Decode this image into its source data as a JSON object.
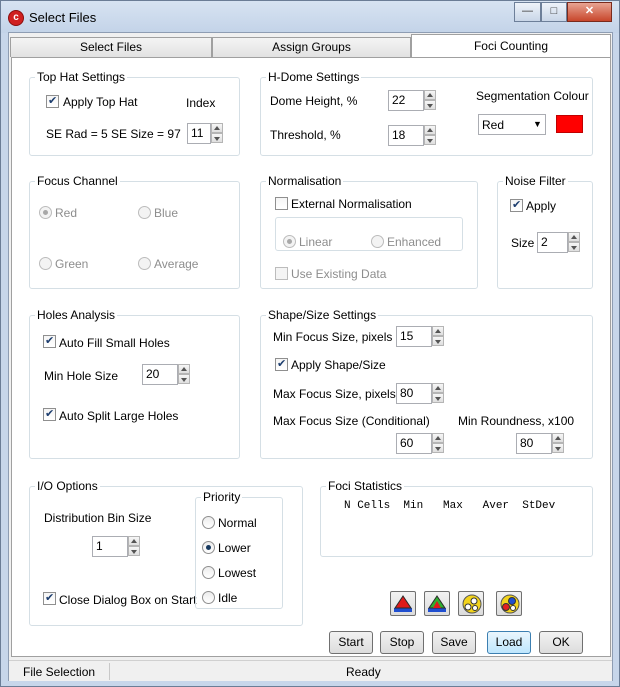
{
  "window": {
    "title": "Select Files",
    "app_icon_glyph": "c"
  },
  "caption_buttons": {
    "minimize": "—",
    "maximize": "□",
    "close": "✕"
  },
  "tabs": [
    {
      "label": "Select Files"
    },
    {
      "label": "Assign Groups"
    },
    {
      "label": "Foci Counting",
      "active": true
    }
  ],
  "top_hat": {
    "legend": "Top Hat Settings",
    "apply_label": "Apply Top Hat",
    "apply_checked": true,
    "index_label": "Index",
    "se_text": "SE Rad = 5  SE Size = 97",
    "index_value": "11"
  },
  "h_dome": {
    "legend": "H-Dome Settings",
    "dome_height_label": "Dome Height, %",
    "dome_height_value": "22",
    "threshold_label": "Threshold, %",
    "threshold_value": "18",
    "seg_colour_label": "Segmentation Colour",
    "seg_colour_value": "Red",
    "seg_colour_hex": "#ff0000"
  },
  "focus_channel": {
    "legend": "Focus Channel",
    "options": [
      "Red",
      "Blue",
      "Green",
      "Average"
    ],
    "selected": "Red"
  },
  "normalisation": {
    "legend": "Normalisation",
    "external_label": "External Normalisation",
    "options": [
      "Linear",
      "Enhanced"
    ],
    "selected": "Linear",
    "use_existing_label": "Use Existing Data"
  },
  "noise_filter": {
    "legend": "Noise Filter",
    "apply_label": "Apply",
    "apply_checked": true,
    "size_label": "Size",
    "size_value": "2"
  },
  "holes": {
    "legend": "Holes Analysis",
    "auto_fill_label": "Auto Fill Small Holes",
    "auto_fill_checked": true,
    "min_hole_label": "Min Hole Size",
    "min_hole_value": "20",
    "auto_split_label": "Auto Split Large Holes",
    "auto_split_checked": true
  },
  "shape": {
    "legend": "Shape/Size Settings",
    "min_focus_label": "Min Focus Size, pixels",
    "min_focus_value": "15",
    "apply_label": "Apply Shape/Size",
    "apply_checked": true,
    "max_focus_label": "Max Focus Size, pixels",
    "max_focus_value": "80",
    "max_cond_label": "Max Focus Size  (Conditional)",
    "max_cond_value": "60",
    "min_round_label": "Min Roundness, x100",
    "min_round_value": "80"
  },
  "io": {
    "legend": "I/O Options",
    "bin_label": "Distribution Bin Size",
    "bin_value": "1",
    "close_label": "Close Dialog Box on Start",
    "close_checked": true,
    "priority_legend": "Priority",
    "priority_options": [
      "Normal",
      "Lower",
      "Lowest",
      "Idle"
    ],
    "priority_selected": "Lower"
  },
  "stats": {
    "legend": "Foci Statistics",
    "header": "N Cells  Min   Max   Aver  StDev"
  },
  "icon_buttons": [
    {
      "name": "red-histogram-icon"
    },
    {
      "name": "multi-histogram-icon"
    },
    {
      "name": "foci-overlay-icon"
    },
    {
      "name": "foci-colour-overlay-icon"
    }
  ],
  "buttons": {
    "start": "Start",
    "stop": "Stop",
    "save": "Save",
    "load": "Load",
    "ok": "OK"
  },
  "status": {
    "left": "File Selection",
    "center": "Ready"
  }
}
